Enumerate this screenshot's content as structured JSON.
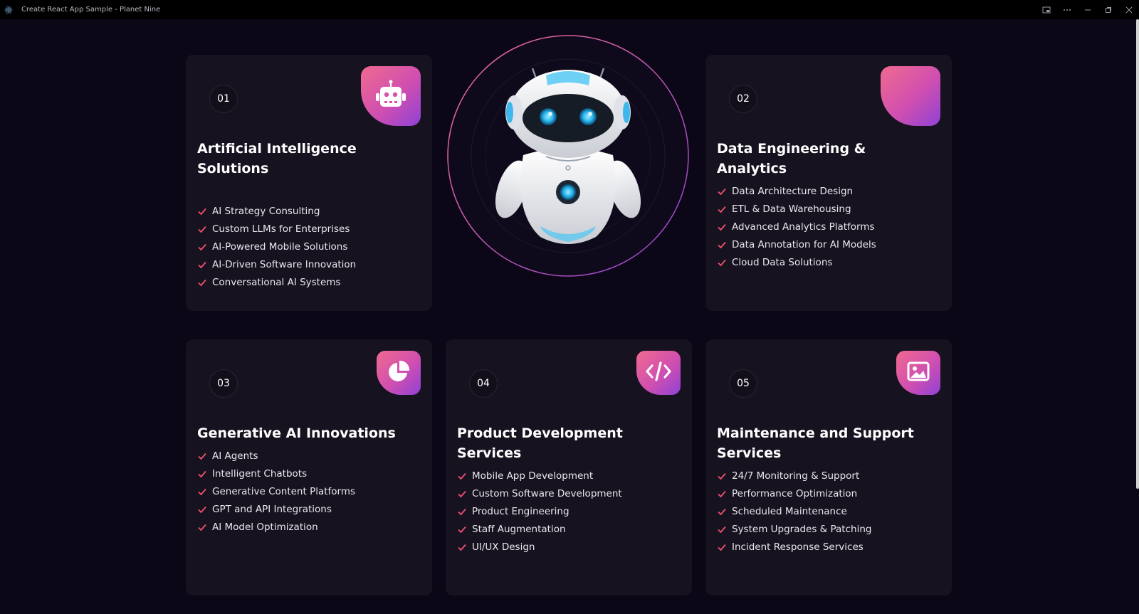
{
  "window": {
    "title": "Create React App Sample - Planet Nine"
  },
  "accent_colors": {
    "gradient_start": "#f06a8f",
    "gradient_end": "#8f42d6",
    "check": "#f0506e",
    "background": "#0b0716",
    "card": "#17121f"
  },
  "cards": [
    {
      "number": "01",
      "title": "Artificial Intelligence Solutions",
      "icon": "robot-icon",
      "items": [
        "AI Strategy Consulting",
        "Custom LLMs for Enterprises",
        "AI-Powered Mobile Solutions",
        "AI-Driven Software Innovation",
        "Conversational AI Systems"
      ]
    },
    {
      "number": "02",
      "title": "Data Engineering & Analytics",
      "icon": "blank-icon",
      "items": [
        "Data Architecture Design",
        "ETL & Data Warehousing",
        "Advanced Analytics Platforms",
        "Data Annotation for AI Models",
        "Cloud Data Solutions"
      ]
    },
    {
      "number": "03",
      "title": "Generative AI Innovations",
      "icon": "pie-chart-icon",
      "items": [
        "AI Agents",
        "Intelligent Chatbots",
        "Generative Content Platforms",
        "GPT and API Integrations",
        "AI Model Optimization"
      ]
    },
    {
      "number": "04",
      "title": "Product Development Services",
      "icon": "code-icon",
      "items": [
        "Mobile App Development",
        "Custom Software Development",
        "Product Engineering",
        "Staff Augmentation",
        "UI/UX Design"
      ]
    },
    {
      "number": "05",
      "title": "Maintenance and Support Services",
      "icon": "image-icon",
      "items": [
        "24/7 Monitoring & Support",
        "Performance Optimization",
        "Scheduled Maintenance",
        "System Upgrades & Patching",
        "Incident Response Services"
      ]
    }
  ]
}
